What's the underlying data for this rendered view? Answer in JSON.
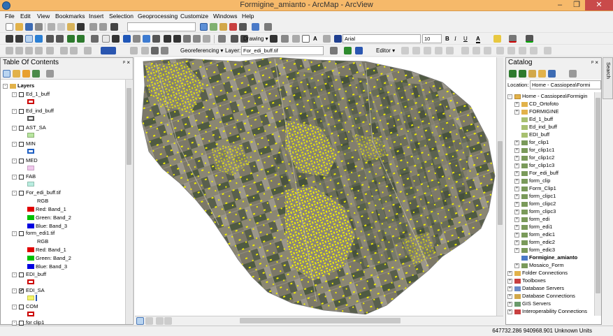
{
  "window": {
    "title": "Formigine_amianto - ArcMap - ArcView",
    "controls": [
      "–",
      "❐",
      "✕"
    ]
  },
  "menu": [
    "File",
    "Edit",
    "View",
    "Bookmarks",
    "Insert",
    "Selection",
    "Geoprocessing",
    "Customize",
    "Windows",
    "Help"
  ],
  "toolbar": {
    "drawing_label": "Drawing ▾",
    "font_name": "Arial",
    "font_size": "10",
    "bold": "B",
    "italic": "I",
    "underline": "U",
    "georeferencing_label": "Georeferencing ▾",
    "layer_label": "Layer:",
    "layer_value": "For_edi_buff.tif",
    "editor_label": "Editor ▾"
  },
  "toc": {
    "title": "Table Of Contents",
    "pin": "ᵖ ×",
    "layers_root": "Layers",
    "items": [
      {
        "label": "Ed_1_buff",
        "expand": "-",
        "checked": "",
        "symbol": "#cc0000"
      },
      {
        "label": "Ed_ind_buff",
        "expand": "-",
        "checked": "",
        "symbol": "#555555"
      },
      {
        "label": "AST_SA",
        "expand": "-",
        "checked": "",
        "symbol": "#b8e6a0"
      },
      {
        "label": "MIN",
        "expand": "-",
        "checked": "",
        "symbol": "#1f5fc2"
      },
      {
        "label": "MED",
        "expand": "-",
        "checked": "",
        "symbol": "#f0c8ec"
      },
      {
        "label": "FAB",
        "expand": "-",
        "checked": "",
        "symbol": "#b9ece0"
      },
      {
        "label": "For_edi_buff.tif",
        "expand": "-",
        "checked": "",
        "symbol": ""
      },
      {
        "label": "form_edi1.tif",
        "expand": "-",
        "checked": "",
        "symbol": ""
      },
      {
        "label": "EDI_buff",
        "expand": "-",
        "checked": "",
        "symbol": "#cc0000"
      },
      {
        "label": "EDI_SA",
        "expand": "-",
        "checked": "✔",
        "symbol": "#f5f56a"
      },
      {
        "label": "COM",
        "expand": "-",
        "checked": "",
        "symbol": "#cc0000"
      },
      {
        "label": "for clip1",
        "expand": "-",
        "checked": "",
        "symbol": ""
      }
    ],
    "raster1": {
      "rgb": "RGB",
      "red": "Red:   Band_1",
      "green": "Green: Band_2",
      "blue": "Blue:  Band_3"
    },
    "raster2": {
      "rgb": "RGB",
      "red": "Red:   Band_1",
      "green": "Green: Band_2",
      "blue": "Blue:  Band_3"
    }
  },
  "catalog": {
    "title": "Catalog",
    "pin": "ᵖ ×",
    "location_label": "Location:",
    "location_value": "Home - Cassiopea\\Formi",
    "home": "Home - Cassiopea\\Formigin",
    "items": [
      {
        "label": "CD_Ortofoto",
        "icon": "folder",
        "exp": "+"
      },
      {
        "label": "FORMIGINE",
        "icon": "folder",
        "exp": "+"
      },
      {
        "label": "Ed_1_buff",
        "icon": "shp",
        "exp": ""
      },
      {
        "label": "Ed_ind_buff",
        "icon": "shp",
        "exp": ""
      },
      {
        "label": "EDI_buff",
        "icon": "shp",
        "exp": ""
      },
      {
        "label": "for_clip1",
        "icon": "raster",
        "exp": "+"
      },
      {
        "label": "for_clip1c1",
        "icon": "raster",
        "exp": "+"
      },
      {
        "label": "for_clip1c2",
        "icon": "raster",
        "exp": "+"
      },
      {
        "label": "for_clip1c3",
        "icon": "raster",
        "exp": "+"
      },
      {
        "label": "For_edi_buff",
        "icon": "raster",
        "exp": "+"
      },
      {
        "label": "form_clip",
        "icon": "raster",
        "exp": "+"
      },
      {
        "label": "Form_Clip1",
        "icon": "raster",
        "exp": "+"
      },
      {
        "label": "form_clipc1",
        "icon": "raster",
        "exp": "+"
      },
      {
        "label": "form_clipc2",
        "icon": "raster",
        "exp": "+"
      },
      {
        "label": "form_clipc3",
        "icon": "raster",
        "exp": "+"
      },
      {
        "label": "form_edi",
        "icon": "raster",
        "exp": "+"
      },
      {
        "label": "form_edi1",
        "icon": "raster",
        "exp": "+"
      },
      {
        "label": "form_edic1",
        "icon": "raster",
        "exp": "+"
      },
      {
        "label": "form_edic2",
        "icon": "raster",
        "exp": "+"
      },
      {
        "label": "form_edic3",
        "icon": "raster",
        "exp": "+"
      },
      {
        "label": "Formigine_amianto",
        "icon": "mxd",
        "exp": ""
      },
      {
        "label": "Mosaico_Form",
        "icon": "raster",
        "exp": "+"
      }
    ],
    "roots": [
      {
        "label": "Folder Connections",
        "exp": "+"
      },
      {
        "label": "Toolboxes",
        "exp": "+"
      },
      {
        "label": "Database Servers",
        "exp": "+"
      },
      {
        "label": "Database Connections",
        "exp": "+"
      },
      {
        "label": "GIS Servers",
        "exp": "+"
      },
      {
        "label": "Interoperability Connections",
        "exp": "+"
      }
    ],
    "search_tab": "Search"
  },
  "status": {
    "coords": "647732.286  940968.901 Unknown Units"
  },
  "colors": {
    "title_bar": "#f6b96a",
    "selection_yellow": "#f2f000",
    "panel_bg": "#f0f0f0"
  }
}
